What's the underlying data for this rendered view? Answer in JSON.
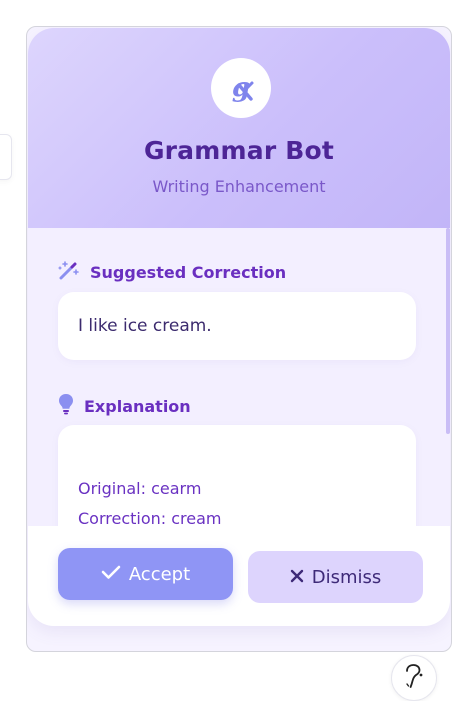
{
  "header": {
    "logo_icon": "grammar-bot-logo",
    "title": "Grammar Bot",
    "subtitle": "Writing Enhancement"
  },
  "correction": {
    "icon": "magic-wand-icon",
    "label": "Suggested Correction",
    "text": "I like ice cream."
  },
  "explanation": {
    "icon": "lightbulb-icon",
    "label": "Explanation",
    "lines": [
      "Original: cearm",
      "Correction: cream"
    ]
  },
  "actions": {
    "accept_label": "Accept",
    "accept_icon": "check-icon",
    "dismiss_label": "Dismiss",
    "dismiss_icon": "close-icon"
  },
  "help_fab_icon": "help-icon",
  "colors": {
    "accent": "#8f95f5",
    "header_bg": "#cbbffb",
    "title": "#4d2596",
    "section_label": "#6a2fc0",
    "dismiss_bg": "#ddd4fd"
  }
}
